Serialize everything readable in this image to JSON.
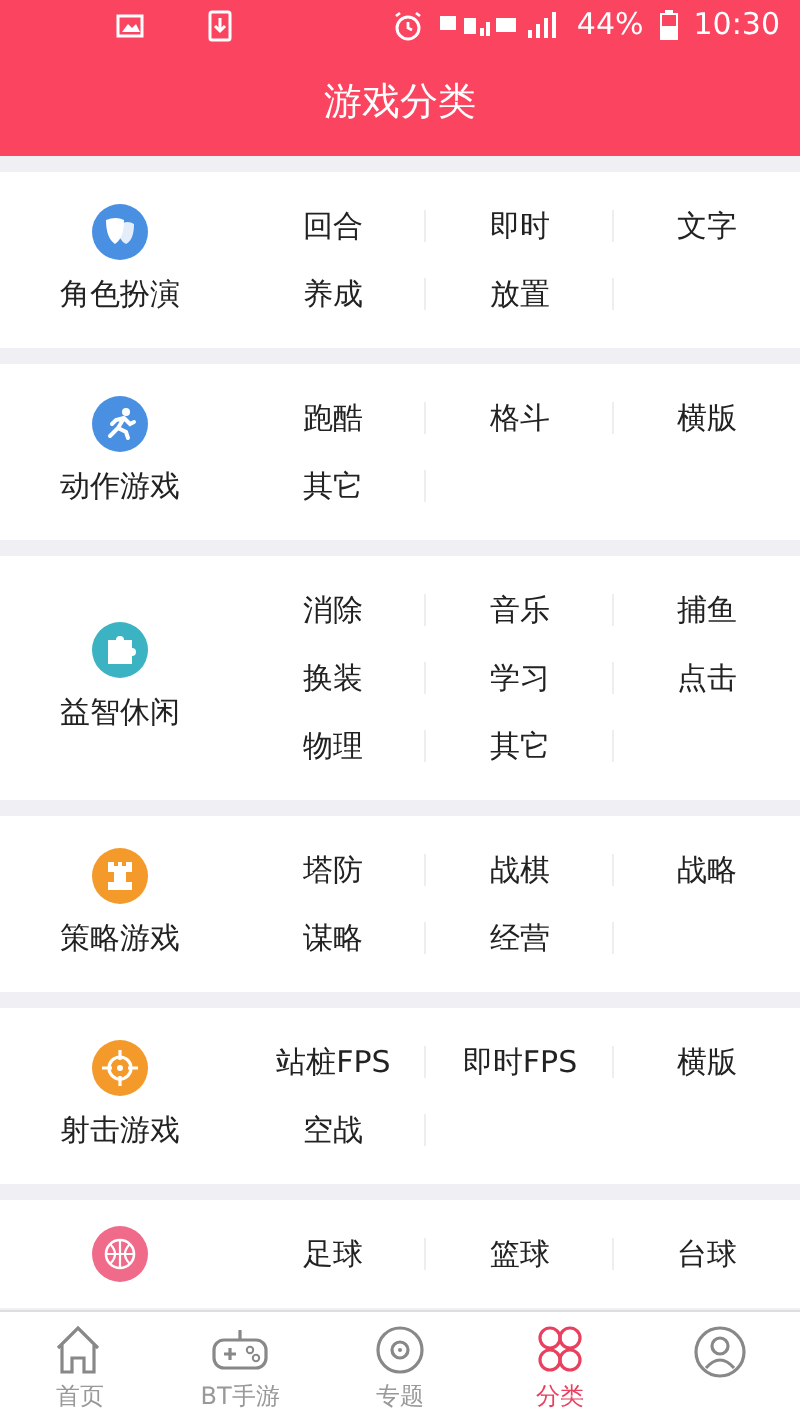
{
  "status_bar": {
    "battery": "44%",
    "time": "10:30"
  },
  "header": {
    "title": "游戏分类"
  },
  "categories": [
    {
      "name": "角色扮演",
      "color": "#4a90e2",
      "items": [
        "回合",
        "即时",
        "文字",
        "养成",
        "放置"
      ]
    },
    {
      "name": "动作游戏",
      "color": "#4a90e2",
      "items": [
        "跑酷",
        "格斗",
        "横版",
        "其它"
      ]
    },
    {
      "name": "益智休闲",
      "color": "#3bb3c3",
      "items": [
        "消除",
        "音乐",
        "捕鱼",
        "换装",
        "学习",
        "点击",
        "物理",
        "其它"
      ]
    },
    {
      "name": "策略游戏",
      "color": "#f39a2b",
      "items": [
        "塔防",
        "战棋",
        "战略",
        "谋略",
        "经营"
      ]
    },
    {
      "name": "射击游戏",
      "color": "#f39a2b",
      "items": [
        "站桩FPS",
        "即时FPS",
        "横版",
        "空战"
      ]
    },
    {
      "color": "#f06b8a",
      "items": [
        "足球",
        "篮球",
        "台球"
      ]
    }
  ],
  "tab_bar": [
    {
      "label": "首页",
      "selected": false
    },
    {
      "label": "BT手游",
      "selected": false
    },
    {
      "label": "专题",
      "selected": false
    },
    {
      "label": "分类",
      "selected": true
    },
    {
      "selected": false
    }
  ]
}
